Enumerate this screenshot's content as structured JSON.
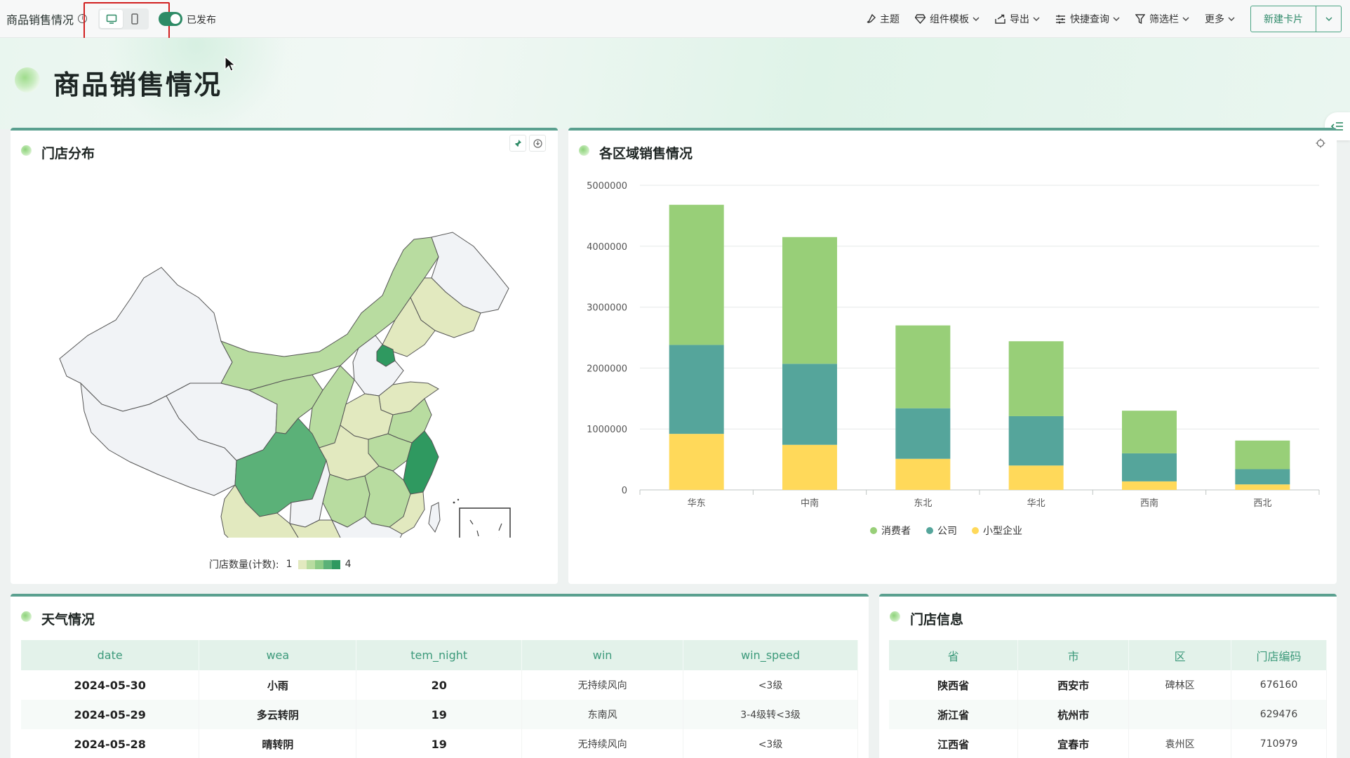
{
  "toolbar": {
    "title": "商品销售情况",
    "publish_label": "已发布",
    "theme_label": "主题",
    "template_label": "组件模板",
    "export_label": "导出",
    "quick_query_label": "快捷查询",
    "filter_bar_label": "筛选栏",
    "more_label": "更多",
    "new_card_label": "新建卡片",
    "device_active": "desktop",
    "publish_on": true
  },
  "header": {
    "title": "商品销售情况"
  },
  "store_map": {
    "title": "门店分布",
    "legend_label": "门店数量(计数):",
    "legend_min": "1",
    "legend_max": "4",
    "scale_colors": [
      "#e2e9bf",
      "#b8dca0",
      "#8ccb86",
      "#5bb178",
      "#2f9960"
    ]
  },
  "region_chart": {
    "title": "各区域销售情况"
  },
  "chart_data": {
    "type": "bar",
    "stacked": true,
    "categories": [
      "华东",
      "中南",
      "东北",
      "华北",
      "西南",
      "西北"
    ],
    "series": [
      {
        "name": "小型企业",
        "color": "#ffd95a",
        "values": [
          920000,
          740000,
          510000,
          400000,
          140000,
          90000
        ]
      },
      {
        "name": "公司",
        "color": "#55a59b",
        "values": [
          1460000,
          1330000,
          830000,
          810000,
          460000,
          250000
        ]
      },
      {
        "name": "消费者",
        "color": "#98cf78",
        "values": [
          2300000,
          2080000,
          1360000,
          1230000,
          700000,
          470000
        ]
      }
    ],
    "yticks": [
      "5000000",
      "4000000",
      "3000000",
      "2000000",
      "1000000",
      "0"
    ],
    "ylim": [
      0,
      5000000
    ],
    "legend_order": [
      "消费者",
      "公司",
      "小型企业"
    ],
    "legend_position": "bottom"
  },
  "weather": {
    "title": "天气情况",
    "columns": [
      "date",
      "wea",
      "tem_night",
      "win",
      "win_speed"
    ],
    "rows": [
      [
        "2024-05-30",
        "小雨",
        "20",
        "无持续风向",
        "<3级"
      ],
      [
        "2024-05-29",
        "多云转阴",
        "19",
        "东南风",
        "3-4级转<3级"
      ],
      [
        "2024-05-28",
        "晴转阴",
        "19",
        "无持续风向",
        "<3级"
      ]
    ]
  },
  "stores": {
    "title": "门店信息",
    "columns": [
      "省",
      "市",
      "区",
      "门店编码"
    ],
    "rows": [
      [
        "陕西省",
        "西安市",
        "碑林区",
        "676160"
      ],
      [
        "浙江省",
        "杭州市",
        "",
        "629476"
      ],
      [
        "江西省",
        "宜春市",
        "袁州区",
        "710979"
      ]
    ]
  }
}
